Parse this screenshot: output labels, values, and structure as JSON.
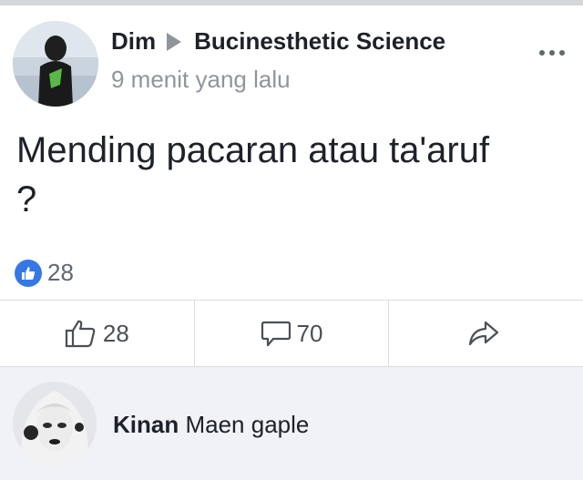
{
  "post": {
    "author": "Dim",
    "group": "Bucinesthetic Science",
    "timestamp": "9 menit yang lalu",
    "text_line1": "Mending pacaran atau ta'aruf",
    "text_line2": "?",
    "reaction_count": "28"
  },
  "actions": {
    "like_count": "28",
    "comment_count": "70"
  },
  "comment": {
    "author": "Kinan",
    "text": "Maen gaple"
  },
  "colors": {
    "accent": "#3578e5",
    "comment_bg": "#f0f2f5"
  },
  "icons": [
    "more-icon",
    "arrow-right-icon",
    "like-badge-icon",
    "thumbs-up-icon",
    "comment-icon",
    "share-icon"
  ]
}
